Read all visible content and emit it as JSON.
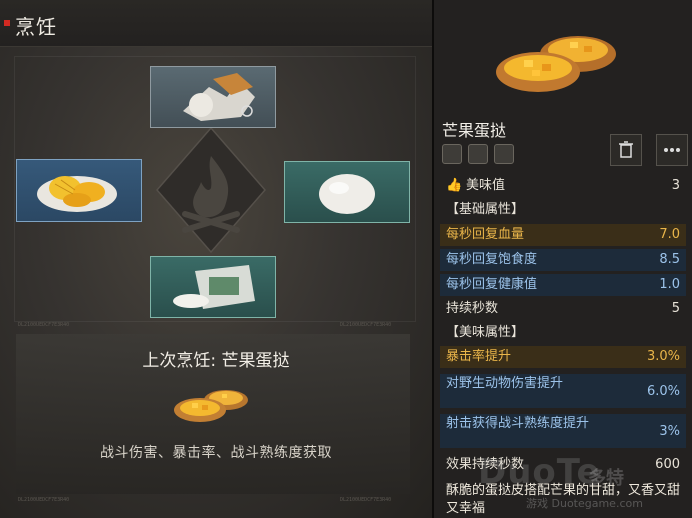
{
  "cooking": {
    "title": "烹饪",
    "last_cook": "上次烹饪: 芒果蛋挞",
    "effects": "战斗伤害、暴击率、战斗熟练度获取",
    "slots": [
      {
        "name": "slot-top",
        "icon": "flour-sugar-ingredient"
      },
      {
        "name": "slot-left",
        "icon": "mango-plate-ingredient"
      },
      {
        "name": "slot-right",
        "icon": "egg-ingredient"
      },
      {
        "name": "slot-bottom",
        "icon": "flour-bag-ingredient"
      }
    ],
    "tiny_codes": [
      "DL2100UEDCF7E3R40",
      "DL2100UEDCF7E3R40",
      "DL2100UEDCF7E3R40",
      "DL2100UEDCF7E3R40"
    ]
  },
  "detail": {
    "name": "芒果蛋挞",
    "buttons": {
      "delete": "trash-icon",
      "more": "more-icon"
    },
    "tags": [
      "cook-tag-icon",
      "no-tag-icon",
      "house-tag-icon"
    ],
    "rows": [
      {
        "k": "美味值",
        "v": "3",
        "style": "plain",
        "icon": "thumb-icon"
      },
      {
        "k": "【基础属性】",
        "v": "",
        "style": "hdr"
      },
      {
        "k": "每秒回复血量",
        "v": "7.0",
        "style": "gold"
      },
      {
        "k": "每秒回复饱食度",
        "v": "8.5",
        "style": "blue"
      },
      {
        "k": "每秒回复健康值",
        "v": "1.0",
        "style": "blue"
      },
      {
        "k": "持续秒数",
        "v": "5",
        "style": "plain"
      },
      {
        "k": "【美味属性】",
        "v": "",
        "style": "hdr"
      },
      {
        "k": "暴击率提升",
        "v": "3.0%",
        "style": "gold"
      },
      {
        "k": "对野生动物伤害提升",
        "v": "6.0%",
        "style": "blue"
      },
      {
        "k": "射击获得战斗熟练度提升",
        "v": "3%",
        "style": "blue"
      },
      {
        "k": "效果持续秒数",
        "v": "600",
        "style": "plain"
      }
    ],
    "description": "酥脆的蛋挞皮搭配芒果的甘甜，又香又甜又幸福"
  },
  "watermark": {
    "logo": "DuoTe",
    "cn": "多特",
    "url": "游戏 Duotegame.com"
  }
}
